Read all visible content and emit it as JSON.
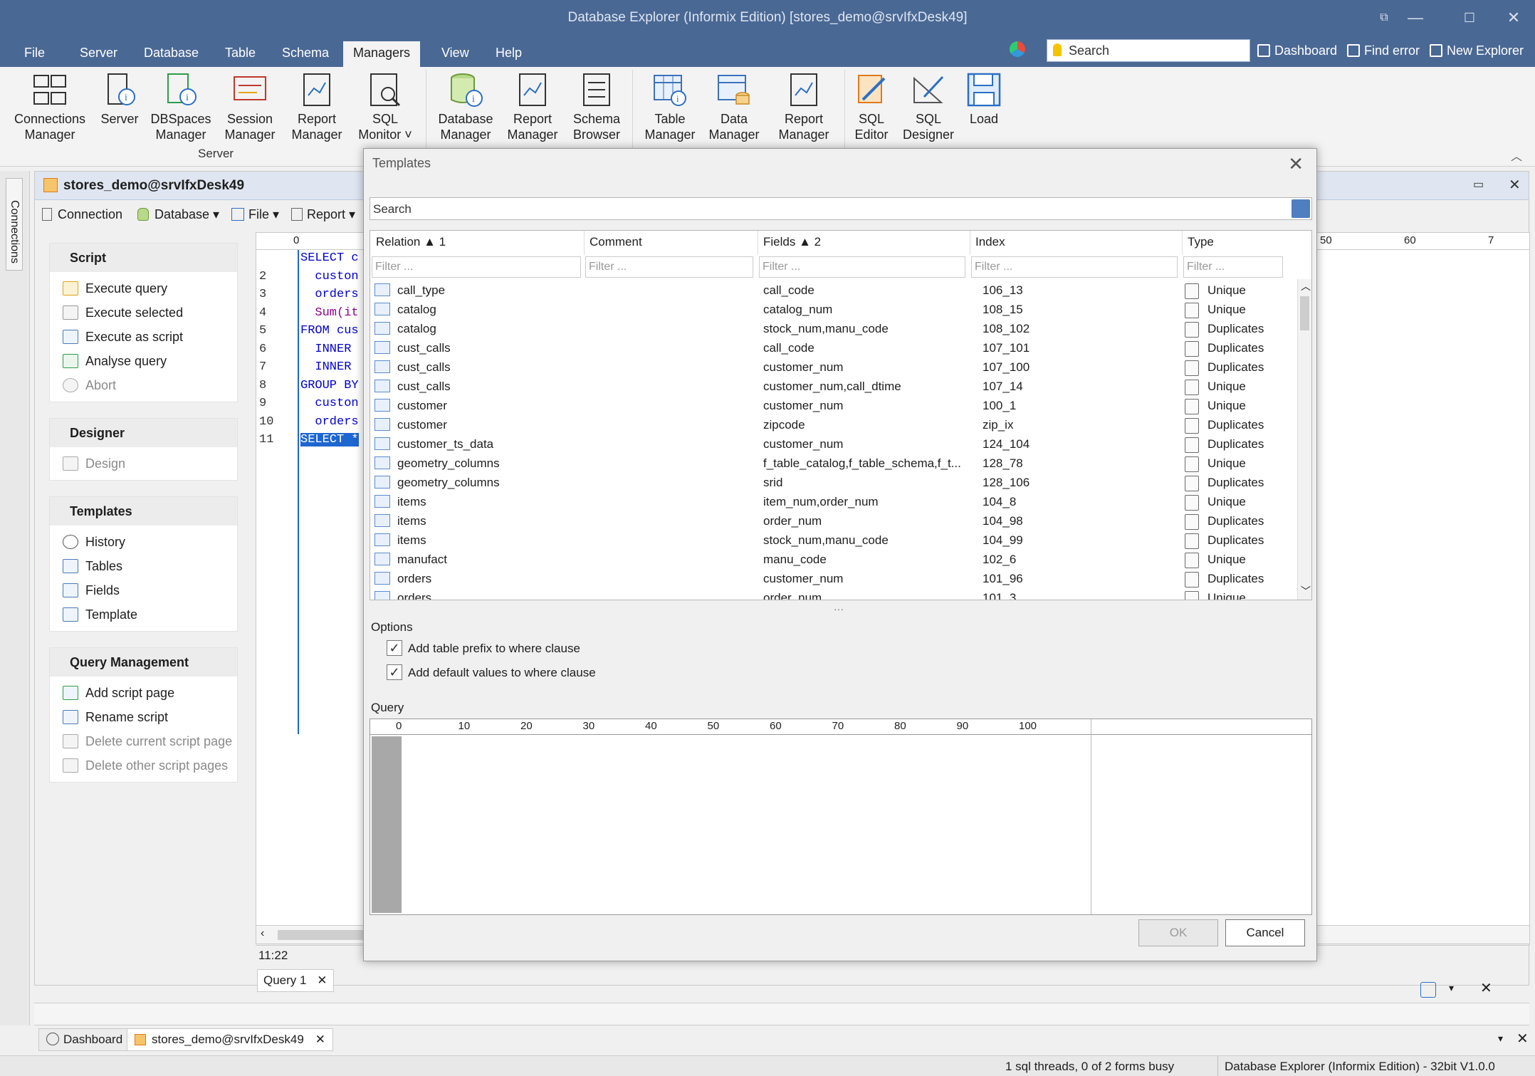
{
  "window": {
    "title": "Database Explorer (Informix Edition) [stores_demo@srvIfxDesk49]",
    "minimize": "—",
    "maximize": "☐",
    "close": "✕"
  },
  "menu": [
    "File",
    "Server",
    "Database",
    "Table",
    "Schema",
    "Managers",
    "View",
    "Help"
  ],
  "active_menu": "Managers",
  "top_search": {
    "placeholder": "Search"
  },
  "quick_links": [
    "Dashboard",
    "Find error",
    "New Explorer"
  ],
  "ribbon": {
    "buttons": [
      {
        "l1": "Connections",
        "l2": "Manager"
      },
      {
        "l1": "Server",
        "l2": ""
      },
      {
        "l1": "DBSpaces",
        "l2": "Manager"
      },
      {
        "l1": "Session",
        "l2": "Manager"
      },
      {
        "l1": "Report",
        "l2": "Manager"
      },
      {
        "l1": "SQL",
        "l2": "Monitor ˅"
      },
      {
        "l1": "Database",
        "l2": "Manager"
      },
      {
        "l1": "Report",
        "l2": "Manager"
      },
      {
        "l1": "Schema",
        "l2": "Browser"
      },
      {
        "l1": "Table",
        "l2": "Manager"
      },
      {
        "l1": "Data",
        "l2": "Manager"
      },
      {
        "l1": "Report",
        "l2": "Manager"
      },
      {
        "l1": "SQL",
        "l2": "Editor"
      },
      {
        "l1": "SQL",
        "l2": "Designer"
      },
      {
        "l1": "Load",
        "l2": ""
      }
    ],
    "group_label": "Server"
  },
  "connections_tab": "Connections",
  "document": {
    "title": "stores_demo@srvIfxDesk49",
    "toolbar": [
      "Connection",
      "Database ▾",
      "File ▾",
      "Report ▾"
    ]
  },
  "side_panel": {
    "sections": [
      {
        "header": "Script",
        "items": [
          {
            "label": "Execute query",
            "disabled": false
          },
          {
            "label": "Execute selected",
            "disabled": false
          },
          {
            "label": "Execute as script",
            "disabled": false
          },
          {
            "label": "Analyse query",
            "disabled": false
          },
          {
            "label": "Abort",
            "disabled": true
          }
        ]
      },
      {
        "header": "Designer",
        "items": [
          {
            "label": "Design",
            "disabled": true
          }
        ]
      },
      {
        "header": "Templates",
        "items": [
          {
            "label": "History",
            "disabled": false
          },
          {
            "label": "Tables",
            "disabled": false
          },
          {
            "label": "Fields",
            "disabled": false
          },
          {
            "label": "Template",
            "disabled": false
          }
        ]
      },
      {
        "header": "Query Management",
        "items": [
          {
            "label": "Add script page",
            "disabled": false
          },
          {
            "label": "Rename script",
            "disabled": false
          },
          {
            "label": "Delete current script page",
            "disabled": true
          },
          {
            "label": "Delete other script pages",
            "disabled": true
          }
        ]
      }
    ]
  },
  "editor": {
    "lines": [
      {
        "no": "",
        "text": "SELECT c"
      },
      {
        "no": "2",
        "text": "  custon"
      },
      {
        "no": "3",
        "text": "  orders"
      },
      {
        "no": "4",
        "text": "  Sum(it"
      },
      {
        "no": "5",
        "text": "FROM cus"
      },
      {
        "no": "6",
        "text": "  INNER"
      },
      {
        "no": "7",
        "text": "  INNER"
      },
      {
        "no": "8",
        "text": "GROUP BY"
      },
      {
        "no": "9",
        "text": "  custon"
      },
      {
        "no": "10",
        "text": "  orders"
      },
      {
        "no": "11",
        "text": "SELECT *"
      }
    ],
    "ruler_marks": [
      "0",
      "50",
      "60",
      "7"
    ],
    "cursor_pos": "11:22",
    "query_tab": "Query 1"
  },
  "bottom_tabs": [
    "Dashboard",
    "stores_demo@srvIfxDesk49"
  ],
  "status": {
    "threads": "1 sql threads, 0 of 2 forms busy",
    "app": "Database Explorer (Informix Edition) - 32bit V1.0.0"
  },
  "dialog": {
    "title": "Templates",
    "search_placeholder": "Search",
    "columns": [
      "Relation ▲ 1",
      "Comment",
      "Fields ▲ 2",
      "Index",
      "Type"
    ],
    "filter_placeholder": "Filter ...",
    "rows": [
      {
        "relation": "call_type",
        "comment": "",
        "fields": "call_code",
        "index": "106_13",
        "type": "Unique"
      },
      {
        "relation": "catalog",
        "comment": "",
        "fields": "catalog_num",
        "index": "108_15",
        "type": "Unique"
      },
      {
        "relation": "catalog",
        "comment": "",
        "fields": "stock_num,manu_code",
        "index": "108_102",
        "type": "Duplicates"
      },
      {
        "relation": "cust_calls",
        "comment": "",
        "fields": "call_code",
        "index": "107_101",
        "type": "Duplicates"
      },
      {
        "relation": "cust_calls",
        "comment": "",
        "fields": "customer_num",
        "index": "107_100",
        "type": "Duplicates"
      },
      {
        "relation": "cust_calls",
        "comment": "",
        "fields": "customer_num,call_dtime",
        "index": "107_14",
        "type": "Unique"
      },
      {
        "relation": "customer",
        "comment": "",
        "fields": "customer_num",
        "index": "100_1",
        "type": "Unique"
      },
      {
        "relation": "customer",
        "comment": "",
        "fields": "zipcode",
        "index": "zip_ix",
        "type": "Duplicates"
      },
      {
        "relation": "customer_ts_data",
        "comment": "",
        "fields": "customer_num",
        "index": "124_104",
        "type": "Duplicates"
      },
      {
        "relation": "geometry_columns",
        "comment": "",
        "fields": "f_table_catalog,f_table_schema,f_t...",
        "index": "128_78",
        "type": "Unique"
      },
      {
        "relation": "geometry_columns",
        "comment": "",
        "fields": "srid",
        "index": "128_106",
        "type": "Duplicates"
      },
      {
        "relation": "items",
        "comment": "",
        "fields": "item_num,order_num",
        "index": "104_8",
        "type": "Unique"
      },
      {
        "relation": "items",
        "comment": "",
        "fields": "order_num",
        "index": "104_98",
        "type": "Duplicates"
      },
      {
        "relation": "items",
        "comment": "",
        "fields": "stock_num,manu_code",
        "index": "104_99",
        "type": "Duplicates"
      },
      {
        "relation": "manufact",
        "comment": "",
        "fields": "manu_code",
        "index": "102_6",
        "type": "Unique"
      },
      {
        "relation": "orders",
        "comment": "",
        "fields": "customer_num",
        "index": "101_96",
        "type": "Duplicates"
      },
      {
        "relation": "orders",
        "comment": "",
        "fields": "order_num",
        "index": "101_3",
        "type": "Unique"
      }
    ],
    "options_label": "Options",
    "options": [
      {
        "label": "Add table prefix to where clause",
        "checked": true
      },
      {
        "label": "Add default values to where clause",
        "checked": true
      }
    ],
    "query_label": "Query",
    "query_ruler": [
      "0",
      "10",
      "20",
      "30",
      "40",
      "50",
      "60",
      "70",
      "80",
      "90",
      "100"
    ],
    "ok": "OK",
    "cancel": "Cancel"
  }
}
